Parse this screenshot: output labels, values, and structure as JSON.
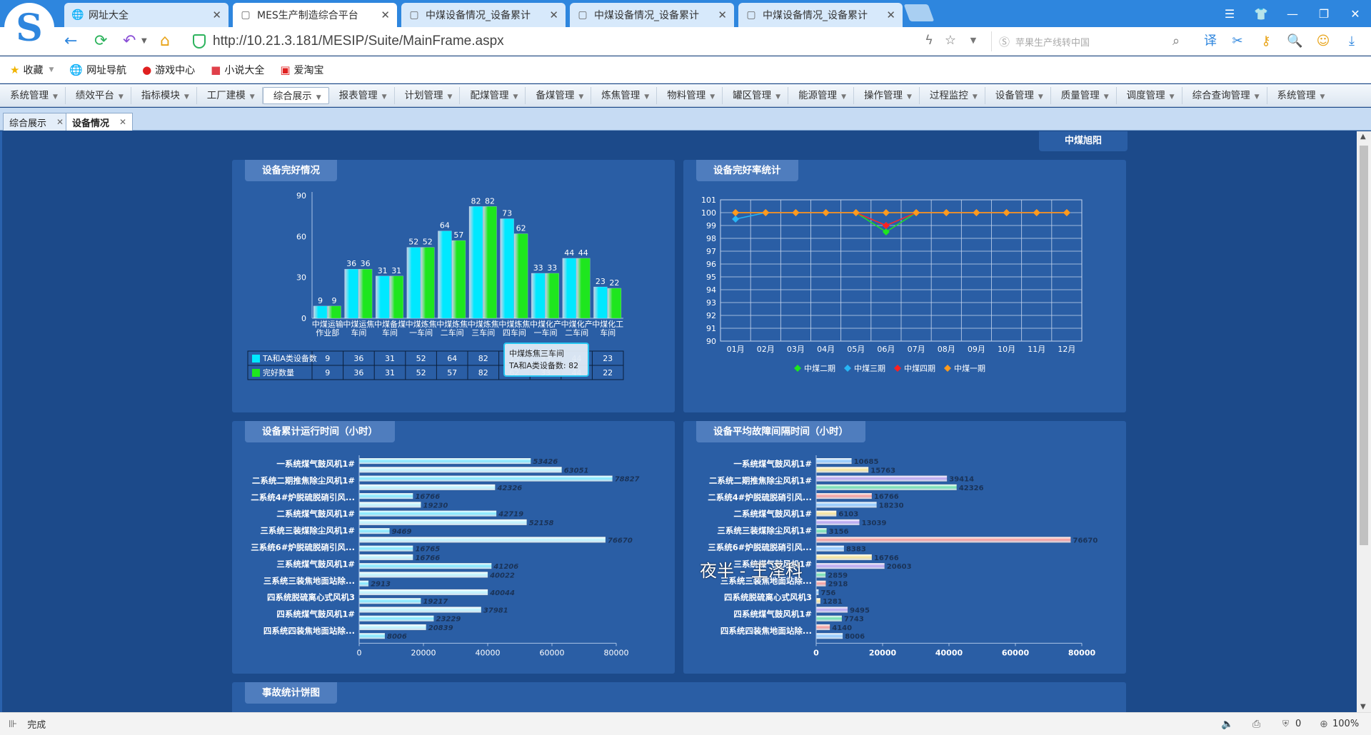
{
  "browser": {
    "tabs": [
      {
        "label": "网址大全",
        "icon": "globe-icon",
        "active": false
      },
      {
        "label": "MES生产制造综合平台",
        "icon": "page-icon",
        "active": true
      },
      {
        "label": "中煤设备情况_设备累计",
        "icon": "page-icon",
        "active": false
      },
      {
        "label": "中煤设备情况_设备累计",
        "icon": "page-icon",
        "active": false
      },
      {
        "label": "中煤设备情况_设备累计",
        "icon": "page-icon",
        "active": false
      }
    ],
    "url": "http://10.21.3.181/MESIP/Suite/MainFrame.aspx",
    "search_placeholder": "苹果生产线转中国",
    "bookmarks": [
      {
        "label": "收藏",
        "icon": "star-icon"
      },
      {
        "label": "网址导航",
        "icon": "globe-icon"
      },
      {
        "label": "游戏中心",
        "icon": "game-icon"
      },
      {
        "label": "小说大全",
        "icon": "book-icon"
      },
      {
        "label": "爱淘宝",
        "icon": "taobao-icon"
      }
    ],
    "status": "完成",
    "zoom": "100%",
    "blocked_count": "0"
  },
  "menu": {
    "items": [
      "系统管理",
      "绩效平台",
      "指标模块",
      "工厂建模",
      "综合展示",
      "报表管理",
      "计划管理",
      "配煤管理",
      "备煤管理",
      "炼焦管理",
      "物料管理",
      "罐区管理",
      "能源管理",
      "操作管理",
      "过程监控",
      "设备管理",
      "质量管理",
      "调度管理",
      "综合查询管理",
      "系统管理"
    ],
    "active": "综合展示"
  },
  "page_tabs": [
    {
      "label": "综合展示",
      "active": false
    },
    {
      "label": "设备情况",
      "active": true
    }
  ],
  "dashboard": {
    "corner_tag": "中煤旭阳",
    "panel1_title": "设备完好情况",
    "panel2_title": "设备完好率统计",
    "panel3_title": "设备累计运行时间（小时）",
    "panel4_title": "设备平均故障间隔时间（小时）",
    "panel5_title": "事故统计饼图",
    "tooltip_line1": "中煤炼焦三车间",
    "tooltip_line2": "TA和A类设备数: 82",
    "overlay_text": "夜半 - 王泽科"
  },
  "chart_data": [
    {
      "type": "bar",
      "title": "设备完好情况",
      "categories": [
        "中煤运输作业部",
        "中煤运焦车间",
        "中煤备煤车间",
        "中煤炼焦一车间",
        "中煤炼焦二车间",
        "中煤炼焦三车间",
        "中煤炼焦四车间",
        "中煤化产一车间",
        "中煤化产二车间",
        "中煤化工车间"
      ],
      "series": [
        {
          "name": "TA和A类设备数",
          "values": [
            9,
            36,
            31,
            52,
            64,
            82,
            73,
            33,
            44,
            23
          ],
          "color": "#00e8ff"
        },
        {
          "name": "完好数量",
          "values": [
            9,
            36,
            31,
            52,
            57,
            82,
            62,
            33,
            44,
            22
          ],
          "color": "#1ee61e"
        }
      ],
      "ylim": [
        0,
        90
      ],
      "yticks": [
        0,
        30,
        60,
        90
      ],
      "legend": "table-bottom"
    },
    {
      "type": "line",
      "title": "设备完好率统计",
      "x": [
        "01月",
        "02月",
        "03月",
        "04月",
        "05月",
        "06月",
        "07月",
        "08月",
        "09月",
        "10月",
        "11月",
        "12月"
      ],
      "series": [
        {
          "name": "中煤二期",
          "color": "#1ee61e",
          "values": [
            100,
            100,
            100,
            100,
            100,
            98.5,
            100,
            100,
            100,
            100,
            100,
            100
          ]
        },
        {
          "name": "中煤三期",
          "color": "#27b6f5",
          "values": [
            99.5,
            100,
            100,
            100,
            100,
            99,
            100,
            100,
            100,
            100,
            100,
            100
          ]
        },
        {
          "name": "中煤四期",
          "color": "#ff2020",
          "values": [
            100,
            100,
            100,
            100,
            100,
            99,
            100,
            100,
            100,
            100,
            100,
            100
          ]
        },
        {
          "name": "中煤一期",
          "color": "#ff9a1e",
          "values": [
            100,
            100,
            100,
            100,
            100,
            100,
            100,
            100,
            100,
            100,
            100,
            100
          ]
        }
      ],
      "ylim": [
        90,
        101
      ],
      "yticks": [
        90,
        91,
        92,
        93,
        94,
        95,
        96,
        97,
        98,
        99,
        100,
        101
      ],
      "grid": true,
      "legend": "bottom"
    },
    {
      "type": "bar",
      "orientation": "horizontal",
      "title": "设备累计运行时间（小时）",
      "categories": [
        "一系统煤气鼓风机1#",
        "二系统二期推焦除尘风机1#",
        "二系统4#炉脱硫脱硝引风...",
        "二系统煤气鼓风机1#",
        "三系统三装煤除尘风机1#",
        "三系统6#炉脱硫脱硝引风...",
        "三系统煤气鼓风机1#",
        "三系统三装焦地面站除...",
        "四系统脱硫离心式风机3",
        "四系统煤气鼓风机1#",
        "四系统四装焦地面站除..."
      ],
      "series": [
        {
          "name": "",
          "values": [
            53426,
            63051,
            78827,
            42326,
            16766,
            19230,
            42719,
            52158,
            9469,
            76670,
            16765,
            16766,
            41206,
            40022,
            2913,
            40044,
            19217,
            37981,
            23229,
            20839,
            8006
          ]
        }
      ],
      "xlim": [
        0,
        80000
      ],
      "xticks": [
        0,
        20000,
        40000,
        60000,
        80000
      ]
    },
    {
      "type": "bar",
      "orientation": "horizontal",
      "title": "设备平均故障间隔时间（小时）",
      "categories": [
        "一系统煤气鼓风机1#",
        "二系统二期推焦除尘风机1#",
        "二系统4#炉脱硫脱硝引风...",
        "二系统煤气鼓风机1#",
        "三系统三装煤除尘风机1#",
        "三系统6#炉脱硫脱硝引风...",
        "三系统煤气鼓风机1#",
        "三系统三装焦地面站除...",
        "四系统脱硫离心式风机3",
        "四系统煤气鼓风机1#",
        "四系统四装焦地面站除..."
      ],
      "series": [
        {
          "name": "",
          "values": [
            10685,
            15763,
            39414,
            42326,
            16766,
            18230,
            6103,
            13039,
            3156,
            76670,
            8383,
            16766,
            20603,
            2859,
            2918,
            756,
            1281,
            9495,
            7743,
            4140,
            8006
          ]
        }
      ],
      "xlim": [
        0,
        80000
      ],
      "xticks": [
        0,
        20000,
        40000,
        60000,
        80000
      ]
    }
  ]
}
